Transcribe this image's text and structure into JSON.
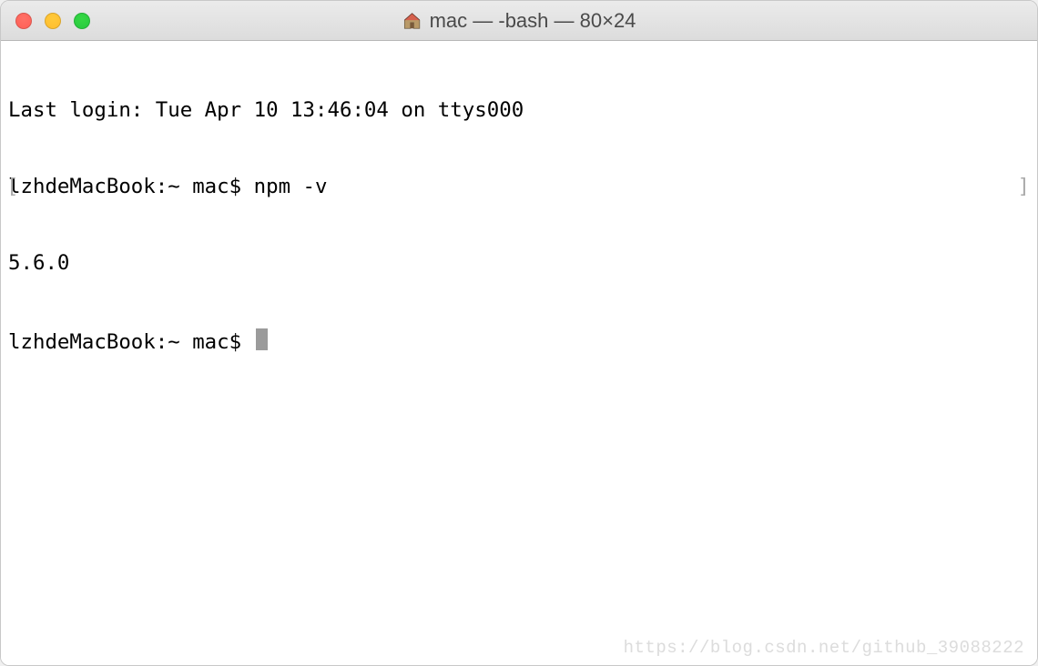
{
  "titlebar": {
    "title": "mac — -bash — 80×24"
  },
  "terminal": {
    "lines": {
      "line1": "Last login: Tue Apr 10 13:46:04 on ttys000",
      "line2_bracket_left": "[",
      "line2_prompt": "lzhdeMacBook:~ mac$ ",
      "line2_command": "npm -v",
      "line2_bracket_right": "]",
      "line3": "5.6.0",
      "line4_prompt": "lzhdeMacBook:~ mac$ "
    }
  },
  "watermark": "https://blog.csdn.net/github_39088222"
}
